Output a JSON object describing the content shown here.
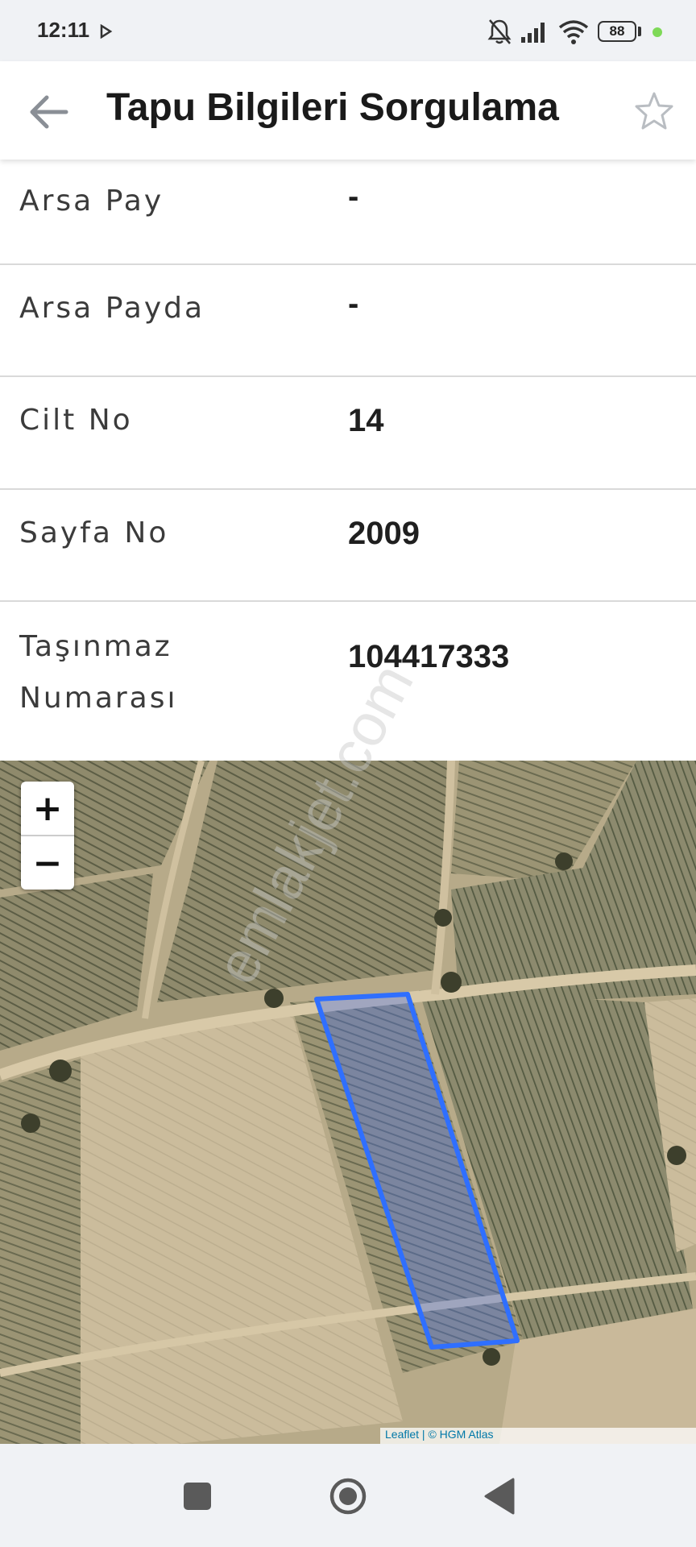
{
  "status_bar": {
    "time": "12:11",
    "battery": "88",
    "icons": [
      "play-icon",
      "silent-bell-icon",
      "signal-icon",
      "wifi-icon",
      "battery-icon"
    ]
  },
  "app_bar": {
    "title": "Tapu Bilgileri Sorgulama",
    "back_icon": "arrow-left-icon",
    "favorite_icon": "star-outline-icon"
  },
  "details": [
    {
      "label": "Arsa Pay",
      "value": "-"
    },
    {
      "label": "Arsa Payda",
      "value": "-"
    },
    {
      "label": "Cilt No",
      "value": "14"
    },
    {
      "label": "Sayfa No",
      "value": "2009"
    },
    {
      "label": "Taşınmaz\nNumarası",
      "value": "104417333"
    }
  ],
  "map": {
    "zoom_in_label": "+",
    "zoom_out_label": "−",
    "attribution": "Leaflet | © HGM Atlas",
    "parcel_color": "#2f6fff"
  },
  "watermark": "emlakjet.com",
  "nav_bar": {
    "icons": [
      "recent-apps-square-icon",
      "home-circle-icon",
      "back-triangle-icon"
    ]
  }
}
